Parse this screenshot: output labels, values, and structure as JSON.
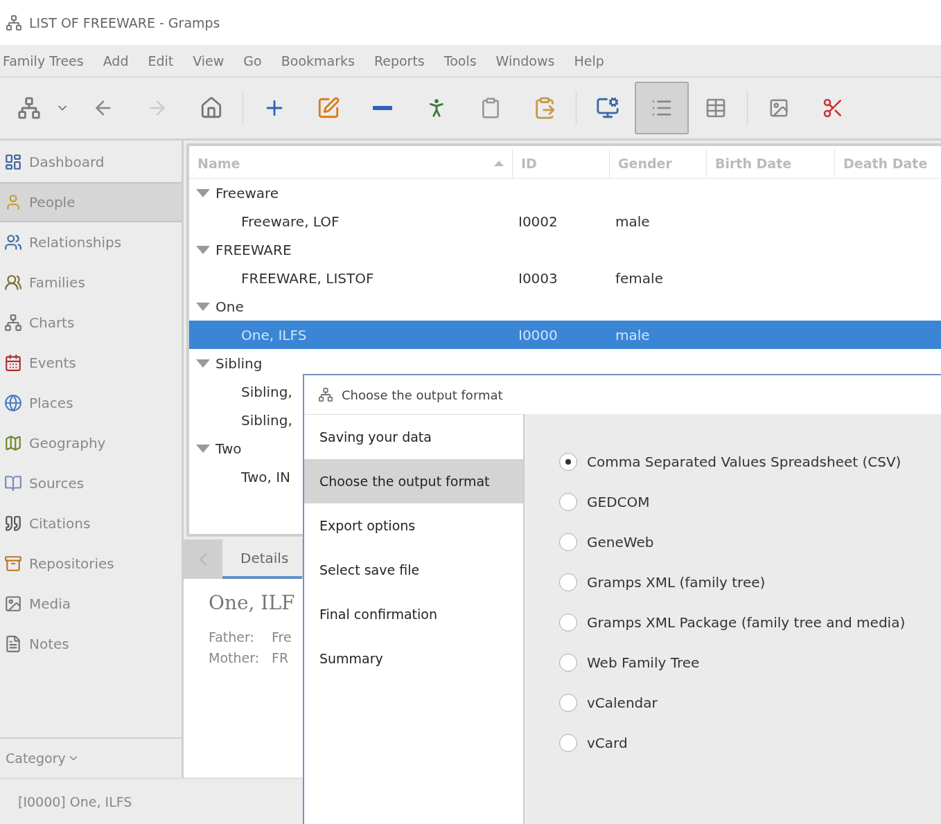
{
  "window": {
    "title": "LIST OF FREEWARE - Gramps"
  },
  "menu": [
    "Family Trees",
    "Add",
    "Edit",
    "View",
    "Go",
    "Bookmarks",
    "Reports",
    "Tools",
    "Windows",
    "Help"
  ],
  "view_buttons": [
    {
      "selected": true
    },
    {
      "selected": false
    }
  ],
  "sidebar": {
    "items": [
      {
        "label": "Dashboard",
        "selected": false
      },
      {
        "label": "People",
        "selected": true
      },
      {
        "label": "Relationships",
        "selected": false
      },
      {
        "label": "Families",
        "selected": false
      },
      {
        "label": "Charts",
        "selected": false
      },
      {
        "label": "Events",
        "selected": false
      },
      {
        "label": "Places",
        "selected": false
      },
      {
        "label": "Geography",
        "selected": false
      },
      {
        "label": "Sources",
        "selected": false
      },
      {
        "label": "Citations",
        "selected": false
      },
      {
        "label": "Repositories",
        "selected": false
      },
      {
        "label": "Media",
        "selected": false
      },
      {
        "label": "Notes",
        "selected": false
      }
    ],
    "category": "Category"
  },
  "table": {
    "columns": [
      "Name",
      "ID",
      "Gender",
      "Birth Date",
      "Death Date"
    ],
    "groups": [
      {
        "name": "Freeware",
        "expanded": true,
        "children": [
          {
            "name": "Freeware, LOF",
            "id": "I0002",
            "gender": "male",
            "selected": false
          }
        ]
      },
      {
        "name": "FREEWARE",
        "expanded": true,
        "children": [
          {
            "name": "FREEWARE, LISTOF",
            "id": "I0003",
            "gender": "female",
            "selected": false
          }
        ]
      },
      {
        "name": "One",
        "expanded": true,
        "children": [
          {
            "name": "One, ILFS",
            "id": "I0000",
            "gender": "male",
            "selected": true
          }
        ]
      },
      {
        "name": "Sibling",
        "expanded": true,
        "children": [
          {
            "name": "Sibling,",
            "selected": false
          },
          {
            "name": "Sibling,",
            "selected": false
          }
        ]
      },
      {
        "name": "Two",
        "expanded": true,
        "children": [
          {
            "name": "Two, IN",
            "selected": false
          }
        ]
      }
    ]
  },
  "bottom_tabs": [
    {
      "label": "Details",
      "selected": true
    }
  ],
  "details": {
    "name": "One, ILF",
    "fields": [
      {
        "label": "Father:",
        "value": "Fre"
      },
      {
        "label": "Mother:",
        "value": "FR"
      }
    ]
  },
  "status_bar": "[I0000] One, ILFS",
  "dialog": {
    "title": "Choose the output format",
    "steps": [
      {
        "label": "Saving your data",
        "selected": false
      },
      {
        "label": "Choose the output format",
        "selected": true
      },
      {
        "label": "Export options",
        "selected": false
      },
      {
        "label": "Select save file",
        "selected": false
      },
      {
        "label": "Final confirmation",
        "selected": false
      },
      {
        "label": "Summary",
        "selected": false
      }
    ],
    "formats": [
      {
        "label": "Comma Separated Values Spreadsheet (CSV)",
        "selected": true
      },
      {
        "label": "GEDCOM",
        "selected": false
      },
      {
        "label": "GeneWeb",
        "selected": false
      },
      {
        "label": "Gramps XML (family tree)",
        "selected": false
      },
      {
        "label": "Gramps XML Package (family tree and media)",
        "selected": false
      },
      {
        "label": "Web Family Tree",
        "selected": false
      },
      {
        "label": "vCalendar",
        "selected": false
      },
      {
        "label": "vCard",
        "selected": false
      }
    ]
  }
}
